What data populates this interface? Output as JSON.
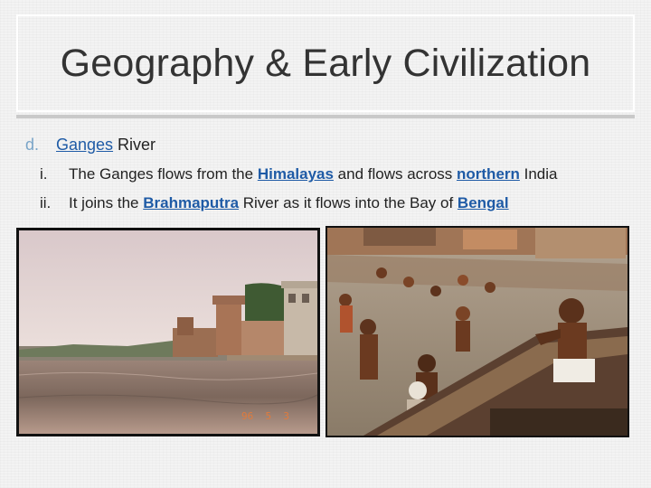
{
  "slide": {
    "title": "Geography & Early Civilization",
    "heading": {
      "marker": "d.",
      "keyword": "Ganges",
      "rest": " River"
    },
    "points": [
      {
        "marker": "i.",
        "pre": "The Ganges flows from the ",
        "link1": "Himalayas",
        "mid": " and flows across ",
        "link2": "northern",
        "post": " India"
      },
      {
        "marker": "ii.",
        "pre": "It joins the ",
        "link1": "Brahmaputra",
        "mid": " River as it flows into the Bay of ",
        "link2": "Bengal"
      }
    ],
    "photos": [
      {
        "caption_stamp": "96  5  3"
      }
    ]
  }
}
